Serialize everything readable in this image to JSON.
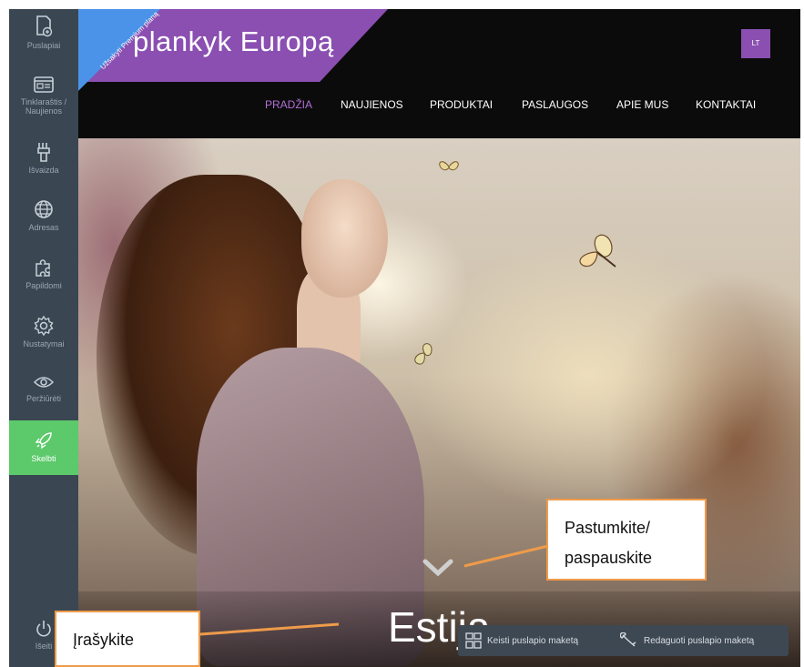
{
  "sidebar": {
    "items": [
      {
        "label": "Puslapiai",
        "icon": "pages-icon"
      },
      {
        "label": "Tinklaraštis / Naujienos",
        "icon": "blog-icon"
      },
      {
        "label": "Išvaizda",
        "icon": "appearance-icon"
      },
      {
        "label": "Adresas",
        "icon": "globe-icon"
      },
      {
        "label": "Papildomi",
        "icon": "puzzle-icon"
      },
      {
        "label": "Nustatymai",
        "icon": "gear-icon"
      },
      {
        "label": "Peržiūrėti",
        "icon": "eye-icon"
      },
      {
        "label": "Skelbti",
        "icon": "rocket-icon"
      }
    ],
    "logout_label": "Išeiti",
    "active_color": "#5cc96b",
    "bg_color": "#3a4753"
  },
  "site": {
    "title": "plankyk Europą",
    "premium_badge": "Užsakyti Premium planą",
    "language": "LT",
    "accent_color": "#8a4fb1",
    "nav": [
      "PRADŽIA",
      "NAUJIENOS",
      "PRODUKTAI",
      "PASLAUGOS",
      "APIE MUS",
      "KONTAKTAI"
    ],
    "hero_title": "Estija"
  },
  "layout_bar": {
    "change_layout": "Keisti puslapio maketą",
    "edit_layout": "Redaguoti puslapio maketą"
  },
  "callouts": {
    "scroll_hint": "Pastumkite/ paspauskite",
    "scroll_hint_line1": "Pastumkite/",
    "scroll_hint_line2": "paspauskite",
    "type_hint": "Įrašykite",
    "border_color": "#ee9b4a"
  }
}
